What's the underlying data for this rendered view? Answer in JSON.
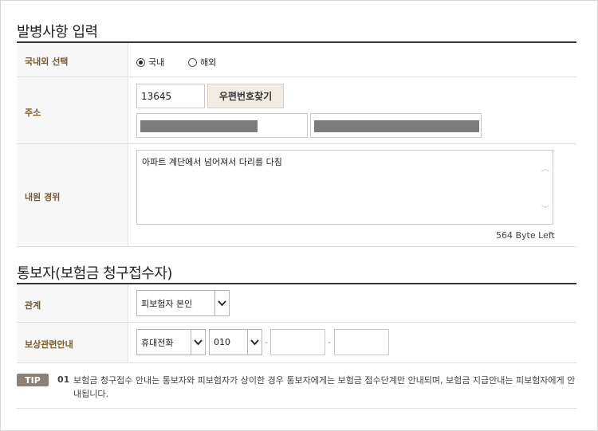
{
  "section1": {
    "title": "발병사항 입력",
    "domestic_row": {
      "label": "국내외 선택",
      "options": [
        "국내",
        "해외"
      ],
      "selected": "국내"
    },
    "address_row": {
      "label": "주소",
      "postal_code": "13645",
      "search_button": "우편번호찾기",
      "address1": "",
      "address2": ""
    },
    "details_row": {
      "label": "내원 경위",
      "text": "아파트 계단에서 넘어져서 다리를 다침",
      "byte_left": "564 Byte Left"
    }
  },
  "section2": {
    "title": "통보자(보험금 청구접수자)",
    "relation_row": {
      "label": "관계",
      "selected": "피보험자 본인"
    },
    "contact_row": {
      "label": "보상관련안내",
      "method": "휴대전화",
      "prefix": "010",
      "middle": "",
      "last": "",
      "separator": "-"
    }
  },
  "tip": {
    "badge": "TIP",
    "number": "01",
    "text": "보험금 청구접수 안내는 통보자와 피보험자가 상이한 경우 통보자에게는 보험금 접수단계만 안내되며, 보험금 지급안내는 피보험자에게 안내됩니다."
  }
}
